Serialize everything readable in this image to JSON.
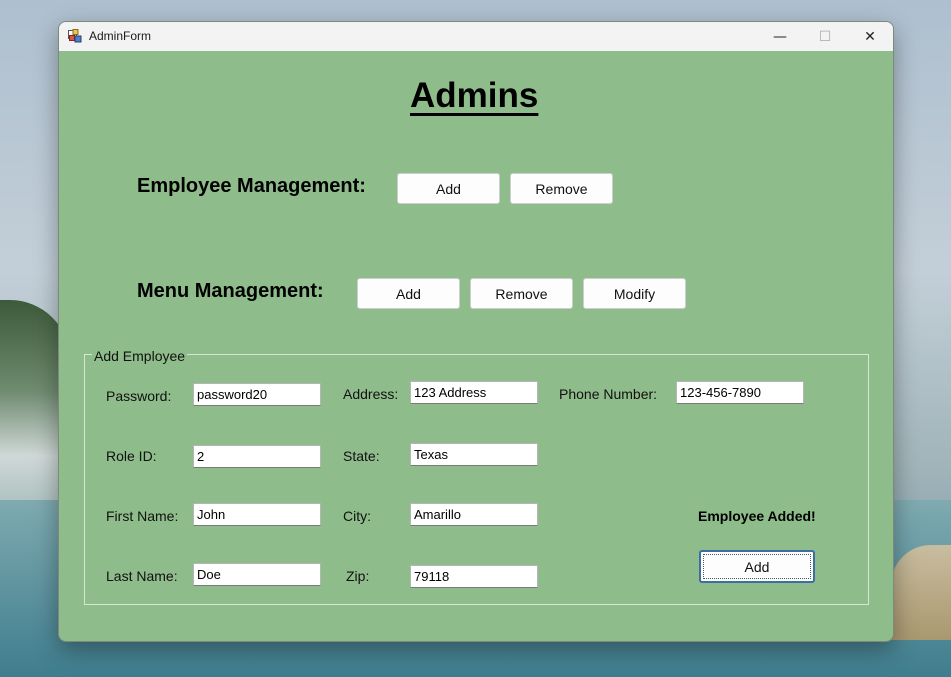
{
  "window": {
    "title": "AdminForm",
    "icon": "app-form-icon",
    "controls": {
      "minimize": "—",
      "maximize": "☐",
      "close": "✕"
    }
  },
  "heading": "Admins",
  "employee_management": {
    "label": "Employee Management:",
    "add_label": "Add",
    "remove_label": "Remove"
  },
  "menu_management": {
    "label": "Menu Management:",
    "add_label": "Add",
    "remove_label": "Remove",
    "modify_label": "Modify"
  },
  "add_employee": {
    "legend": "Add Employee",
    "fields": {
      "password": {
        "label": "Password:",
        "value": "password20"
      },
      "role_id": {
        "label": "Role ID:",
        "value": "2"
      },
      "first_name": {
        "label": "First Name:",
        "value": "John"
      },
      "last_name": {
        "label": "Last Name:",
        "value": "Doe"
      },
      "address": {
        "label": "Address:",
        "value": "123 Address"
      },
      "state": {
        "label": "State:",
        "value": "Texas"
      },
      "city": {
        "label": "City:",
        "value": "Amarillo"
      },
      "zip": {
        "label": "Zip:",
        "value": "79118"
      },
      "phone": {
        "label": "Phone Number:",
        "value": "123-456-7890"
      }
    },
    "status_text": "Employee Added!",
    "submit_label": "Add"
  },
  "colors": {
    "form_background": "#8fbc8b",
    "focus_border": "#3a6ea5"
  }
}
